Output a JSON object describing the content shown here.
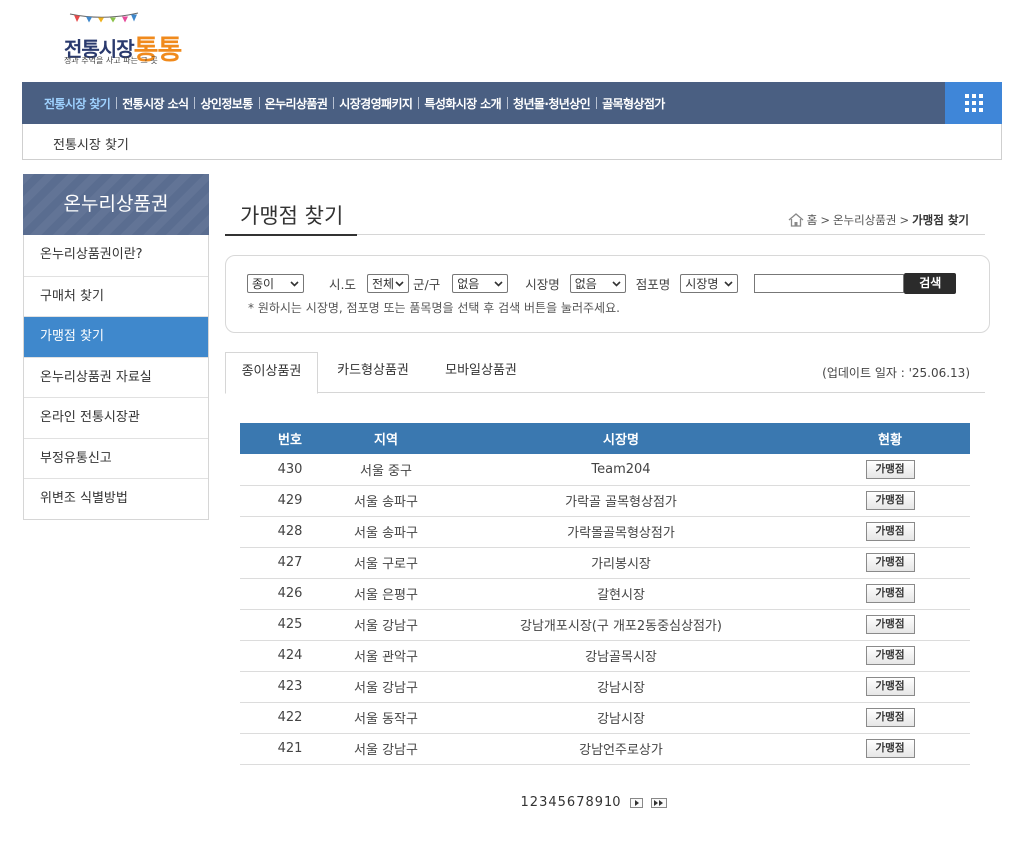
{
  "logo": {
    "name_main": "전통시장",
    "name_highlight": "통통",
    "tagline": "정과 추억을 사고 파는 그 곳"
  },
  "topnav": {
    "items": [
      {
        "label": "전통시장 찾기",
        "active": true
      },
      {
        "label": "전통시장 소식"
      },
      {
        "label": "상인정보통"
      },
      {
        "label": "온누리상품권"
      },
      {
        "label": "시장경영패키지"
      },
      {
        "label": "특성화시장 소개"
      },
      {
        "label": "청년몰·청년상인"
      },
      {
        "label": "골목형상점가"
      }
    ],
    "all_menu_icon": "grid-icon"
  },
  "subbar": {
    "label": "전통시장 찾기"
  },
  "sidebar": {
    "title": "온누리상품권",
    "items": [
      {
        "label": "온누리상품권이란?"
      },
      {
        "label": "구매처 찾기"
      },
      {
        "label": "가맹점 찾기",
        "active": true
      },
      {
        "label": "온누리상품권 자료실"
      },
      {
        "label": "온라인 전통시장관"
      },
      {
        "label": "부정유통신고"
      },
      {
        "label": "위변조 식별방법"
      }
    ]
  },
  "page": {
    "title": "가맹점 찾기",
    "breadcrumb": {
      "home": "홈",
      "sep": ">",
      "level1": "온누리상품권",
      "current": "가맹점 찾기"
    }
  },
  "search": {
    "type_select": "종이",
    "sido_label": "시.도",
    "sido_select": "전체",
    "gugun_label": "군/구",
    "gugun_select": "없음",
    "market_label": "시장명",
    "market_select": "없음",
    "store_label": "점포명",
    "store_select": "시장명",
    "keyword_value": "",
    "button_label": "검색",
    "notice": "* 원하시는 시장명, 점포명 또는 품목명을 선택 후 검색 버튼을 눌러주세요."
  },
  "tabs": [
    {
      "label": "종이상품권",
      "active": true
    },
    {
      "label": "카드형상품권"
    },
    {
      "label": "모바일상품권"
    }
  ],
  "update_date": "(업데이트 일자 : '25.06.13)",
  "table": {
    "headers": [
      "번호",
      "지역",
      "시장명",
      "현황"
    ],
    "button_label": "가맹점",
    "rows": [
      {
        "no": "430",
        "region": "서울 중구",
        "market": "Team204"
      },
      {
        "no": "429",
        "region": "서울 송파구",
        "market": "가락골 골목형상점가"
      },
      {
        "no": "428",
        "region": "서울 송파구",
        "market": "가락몰골목형상점가"
      },
      {
        "no": "427",
        "region": "서울 구로구",
        "market": "가리봉시장"
      },
      {
        "no": "426",
        "region": "서울 은평구",
        "market": "갈현시장"
      },
      {
        "no": "425",
        "region": "서울 강남구",
        "market": "강남개포시장(구 개포2동중심상점가)"
      },
      {
        "no": "424",
        "region": "서울 관악구",
        "market": "강남골목시장"
      },
      {
        "no": "423",
        "region": "서울 강남구",
        "market": "강남시장"
      },
      {
        "no": "422",
        "region": "서울 동작구",
        "market": "강남시장"
      },
      {
        "no": "421",
        "region": "서울 강남구",
        "market": "강남언주로상가"
      }
    ]
  },
  "pagination": {
    "pages": [
      "1",
      "2",
      "3",
      "4",
      "5",
      "6",
      "7",
      "8",
      "9",
      "10"
    ],
    "next_icon": "next-icon",
    "last_icon": "last-icon"
  }
}
